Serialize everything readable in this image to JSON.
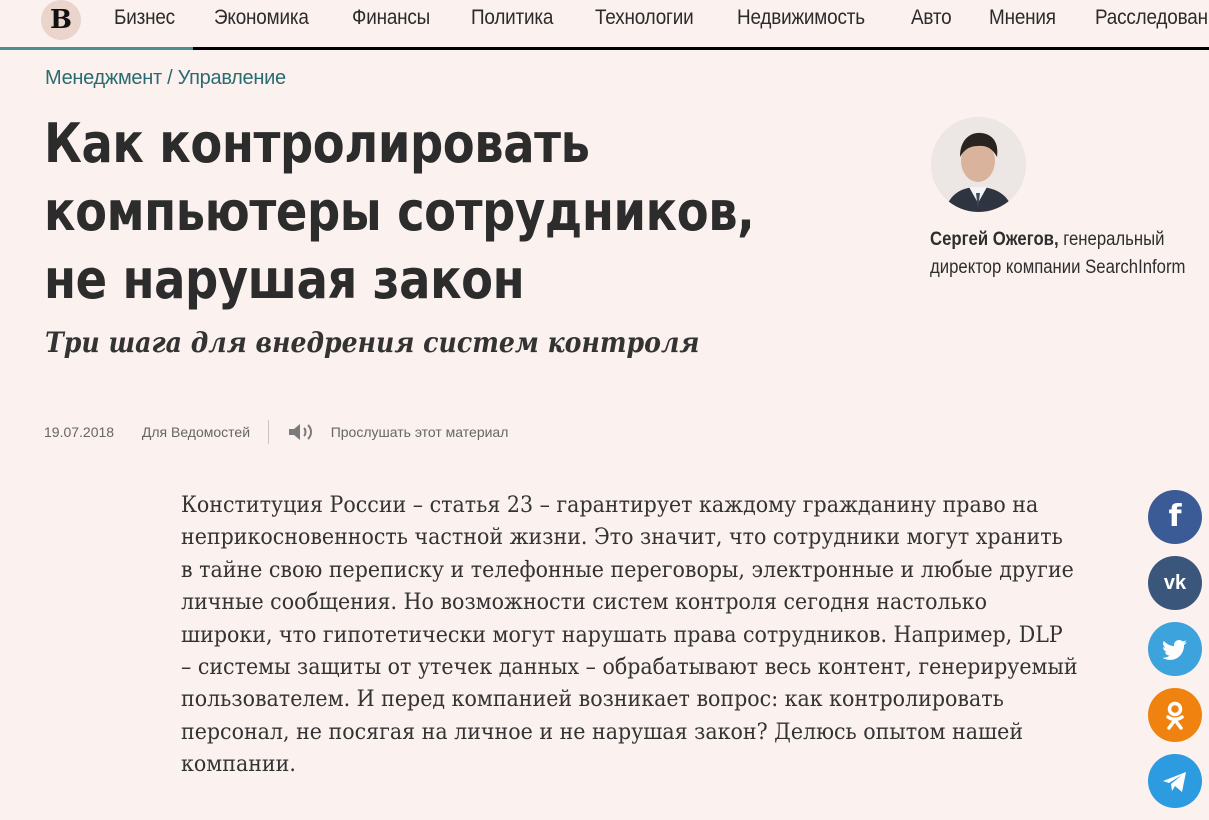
{
  "logo": {
    "letter": "В"
  },
  "nav": [
    {
      "label": "Бизнес"
    },
    {
      "label": "Экономика"
    },
    {
      "label": "Финансы"
    },
    {
      "label": "Политика"
    },
    {
      "label": "Технологии"
    },
    {
      "label": "Недвижимость"
    },
    {
      "label": "Авто"
    },
    {
      "label": "Мнения"
    },
    {
      "label": "Расследования"
    }
  ],
  "article": {
    "rubric": "Менеджмент / Управление",
    "title": "Как контролировать компьютеры сотрудников, не нарушая закон",
    "subtitle": "Три шага для внедрения систем контроля",
    "date": "19.07.2018",
    "source": "Для Ведомостей",
    "listen_label": "Прослушать этот материал",
    "body": "Конституция России – статья 23 – гарантирует каждому гражданину право на неприкосновенность частной жизни. Это значит, что сотрудники могут хранить в тайне свою переписку и телефонные переговоры, электронные и любые другие личные сообщения. Но возможности систем контроля сегодня настолько широки, что гипотетически могут нарушать права сотрудников. Например, DLP – системы защиты от утечек данных – обрабатывают весь контент, генерируемый пользователем. И перед компанией возникает вопрос: как контролировать персонал, не посягая на личное и не нарушая закон? Делюсь опытом нашей компании."
  },
  "author": {
    "name": "Сергей Ожегов,",
    "role_line1": "генеральный",
    "role_line2": "директор компании SearchInform"
  },
  "share": {
    "facebook_glyph": "f",
    "vk_glyph": "vk",
    "colors": {
      "facebook": "#3b5b97",
      "vk": "#3a567a",
      "twitter": "#3ca3dc",
      "ok": "#f0830f",
      "telegram": "#2d9be0"
    }
  },
  "colors": {
    "background": "#fbf1ee",
    "accent": "#4d8c90",
    "rubric": "#2a6b6f"
  }
}
